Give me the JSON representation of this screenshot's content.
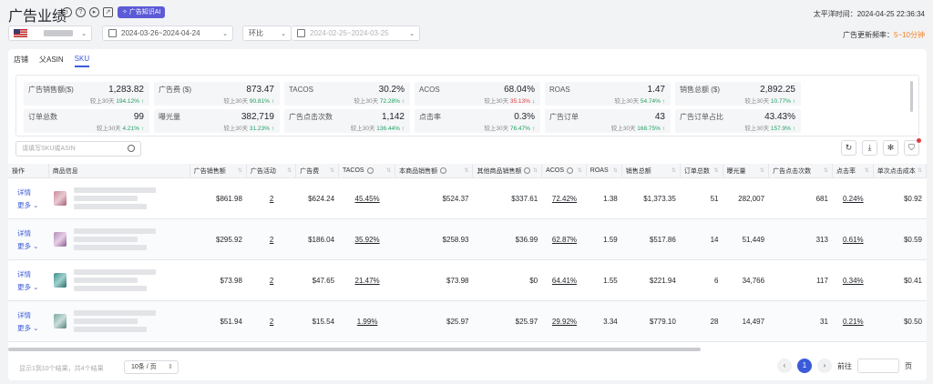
{
  "header": {
    "title": "广告业绩",
    "ai_badge": "广告知识AI",
    "timezone_label": "太平洋时间：",
    "timezone_value": "2024-04-25 22:36:34",
    "date_range": "2024-03-26~2024-04-24",
    "compare_mode": "环比",
    "compare_range": "2024-02-25~2024-03-25",
    "freq_label": "广告更新频率：",
    "freq_value": "5~10分钟"
  },
  "tabs": [
    "店铺",
    "父ASIN",
    "SKU"
  ],
  "metrics": [
    {
      "label": "广告销售额($)",
      "value": "1,283.82",
      "cmp": "较上30天",
      "pct": "194.12%",
      "dir": "up"
    },
    {
      "label": "广告费 ($)",
      "value": "873.47",
      "cmp": "较上30天",
      "pct": "90.81%",
      "dir": "up"
    },
    {
      "label": "TACOS",
      "value": "30.2%",
      "cmp": "较上30天",
      "pct": "72.28%",
      "dir": "up"
    },
    {
      "label": "ACOS",
      "value": "68.04%",
      "cmp": "较上30天",
      "pct": "35.13%",
      "dir": "down"
    },
    {
      "label": "ROAS",
      "value": "1.47",
      "cmp": "较上30天",
      "pct": "54.74%",
      "dir": "up"
    },
    {
      "label": "销售总额 ($)",
      "value": "2,892.25",
      "cmp": "较上30天",
      "pct": "10.77%",
      "dir": "up"
    },
    {
      "label": "订单总数",
      "value": "99",
      "cmp": "较上30天",
      "pct": "4.21%",
      "dir": "up"
    },
    {
      "label": "曝光量",
      "value": "382,719",
      "cmp": "较上30天",
      "pct": "31.23%",
      "dir": "up"
    },
    {
      "label": "广告点击次数",
      "value": "1,142",
      "cmp": "较上30天",
      "pct": "136.44%",
      "dir": "up"
    },
    {
      "label": "点击率",
      "value": "0.3%",
      "cmp": "较上30天",
      "pct": "76.47%",
      "dir": "up"
    },
    {
      "label": "广告订单",
      "value": "43",
      "cmp": "较上30天",
      "pct": "168.75%",
      "dir": "up"
    },
    {
      "label": "广告订单占比",
      "value": "43.43%",
      "cmp": "较上30天",
      "pct": "157.9%",
      "dir": "up"
    }
  ],
  "search": {
    "placeholder": "请填写SKU或ASIN"
  },
  "table": {
    "columns": [
      "操作",
      "商品信息",
      "广告销售额",
      "广告活动",
      "广告费",
      "TACOS",
      "本商品销售额",
      "其他商品销售额",
      "ACOS",
      "ROAS",
      "销售总额",
      "订单总数",
      "曝光量",
      "广告点击次数",
      "点击率",
      "单次点击成本"
    ],
    "op_detail": "详情",
    "op_more": "更多",
    "rows": [
      {
        "ad_sales": "$861.98",
        "campaigns": "2",
        "ad_spend": "$624.24",
        "tacos": "45.45%",
        "own_sales": "$524.37",
        "other_sales": "$337.61",
        "acos": "72.42%",
        "roas": "1.38",
        "total_sales": "$1,373.35",
        "orders": "51",
        "impressions": "282,007",
        "clicks": "681",
        "ctr": "0.24%",
        "cpc": "$0.92"
      },
      {
        "ad_sales": "$295.92",
        "campaigns": "2",
        "ad_spend": "$186.04",
        "tacos": "35.92%",
        "own_sales": "$258.93",
        "other_sales": "$36.99",
        "acos": "62.87%",
        "roas": "1.59",
        "total_sales": "$517.86",
        "orders": "14",
        "impressions": "51,449",
        "clicks": "313",
        "ctr": "0.61%",
        "cpc": "$0.59"
      },
      {
        "ad_sales": "$73.98",
        "campaigns": "2",
        "ad_spend": "$47.65",
        "tacos": "21.47%",
        "own_sales": "$73.98",
        "other_sales": "$0",
        "acos": "64.41%",
        "roas": "1.55",
        "total_sales": "$221.94",
        "orders": "6",
        "impressions": "34,766",
        "clicks": "117",
        "ctr": "0.34%",
        "cpc": "$0.41"
      },
      {
        "ad_sales": "$51.94",
        "campaigns": "2",
        "ad_spend": "$15.54",
        "tacos": "1.99%",
        "own_sales": "$25.97",
        "other_sales": "$25.97",
        "acos": "29.92%",
        "roas": "3.34",
        "total_sales": "$779.10",
        "orders": "28",
        "impressions": "14,497",
        "clicks": "31",
        "ctr": "0.21%",
        "cpc": "$0.50"
      }
    ]
  },
  "footer": {
    "count": "显示1到10个结果，共4个结果",
    "page_size": "10条 / 页",
    "current_page": "1",
    "goto": "前往",
    "page_unit": "页"
  }
}
